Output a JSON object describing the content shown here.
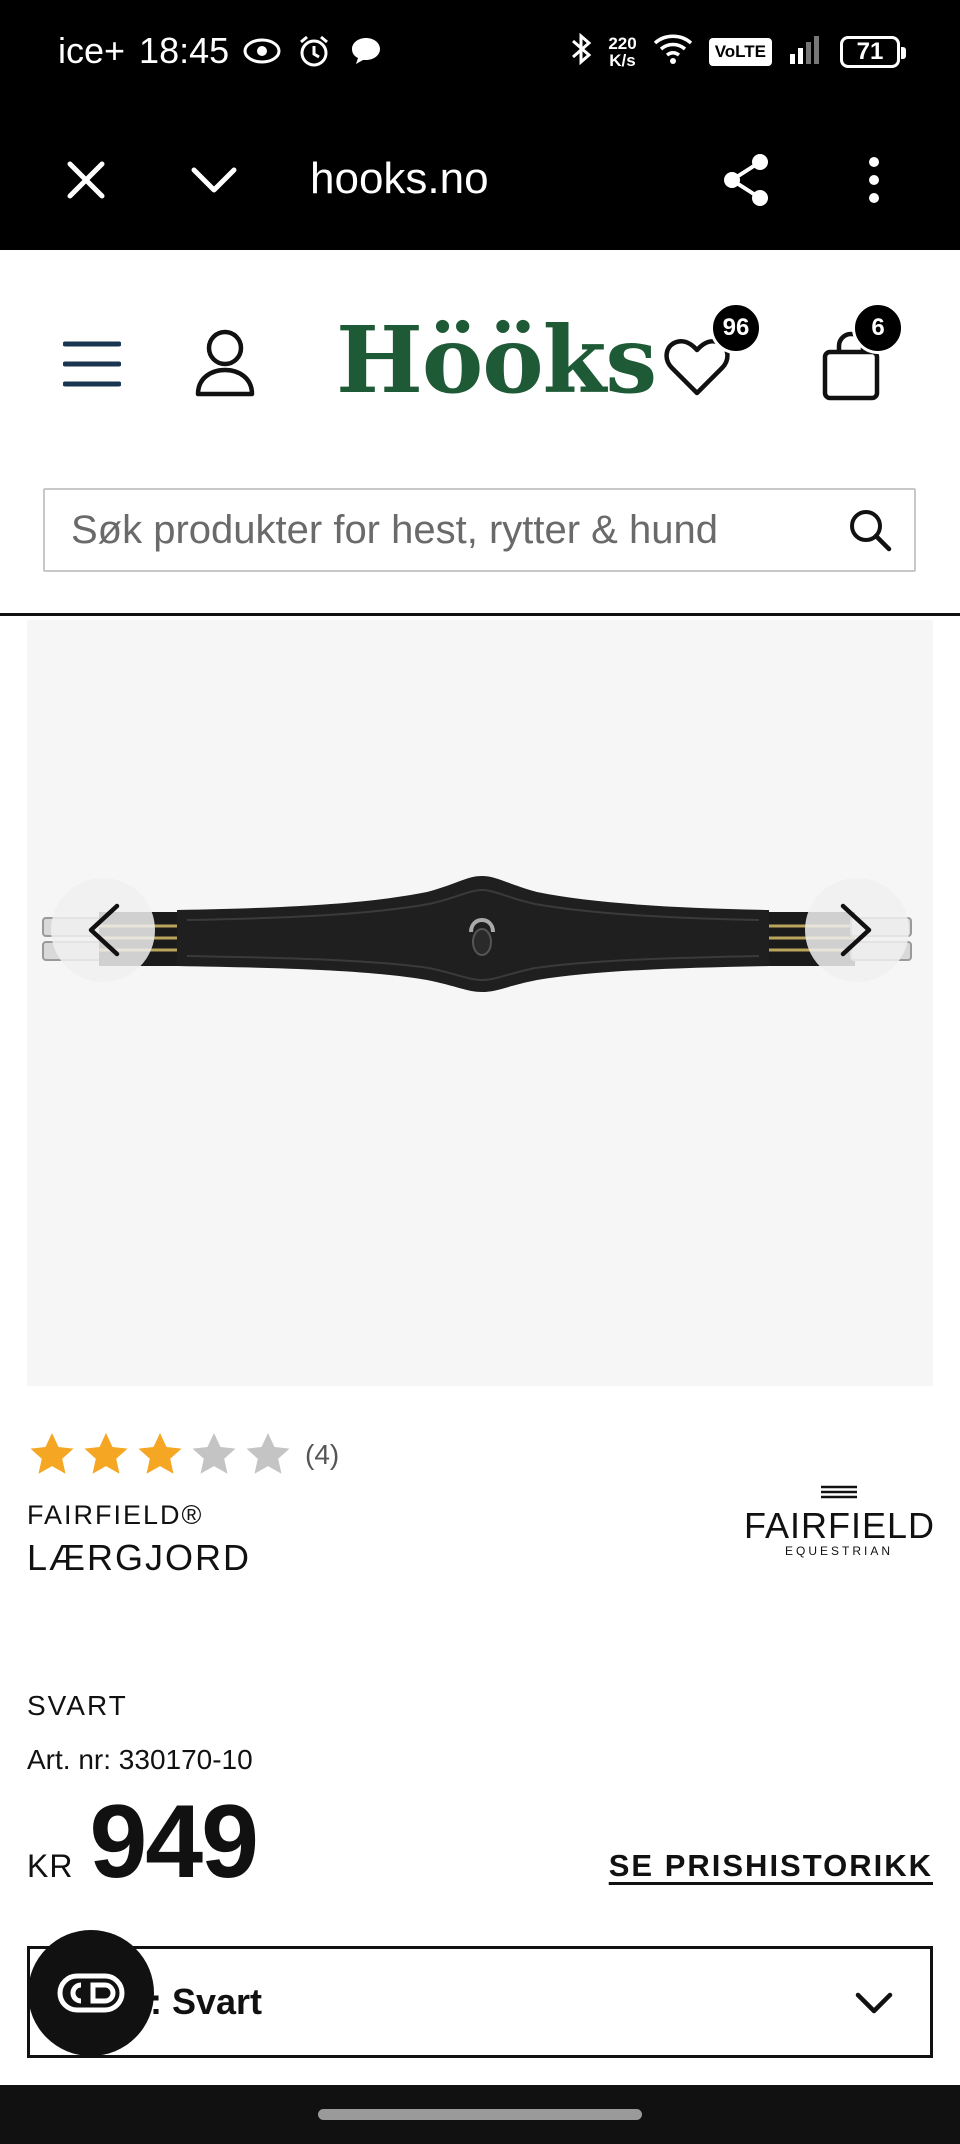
{
  "status_bar": {
    "carrier": "ice+",
    "time": "18:45",
    "net_speed_value": "220",
    "net_speed_unit": "K/s",
    "volte": "VoLTE",
    "battery": "71"
  },
  "browser": {
    "url": "hooks.no"
  },
  "header": {
    "logo": "Hööks",
    "wishlist_count": "96",
    "cart_count": "6",
    "search_placeholder": "Søk produkter for hest, rytter & hund"
  },
  "product": {
    "rating": 3,
    "rating_max": 5,
    "review_count": "(4)",
    "brand": "FAIRFIELD®",
    "name": "LÆRGJORD",
    "brand_logo_main": "FAIRFIELD",
    "brand_logo_sub": "EQUESTRIAN",
    "color": "SVART",
    "article_number": "Art. nr: 330170-10",
    "currency": "KR",
    "price": "949",
    "price_history_link": "SE PRISHISTORIKK",
    "variant_selected": ": Svart"
  },
  "colors": {
    "brand_green": "#1e5a36",
    "star_filled": "#f5a623",
    "star_empty": "#c4c4c4"
  }
}
